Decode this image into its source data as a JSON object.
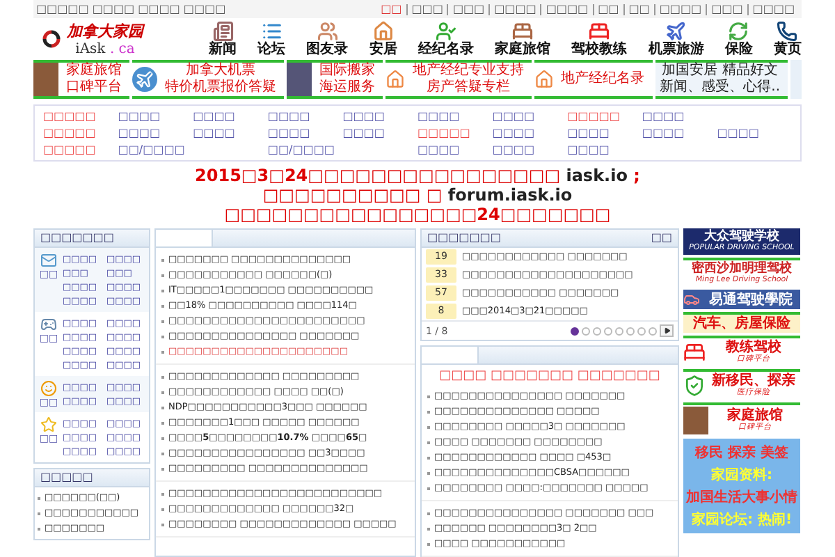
{
  "top_bar": {
    "left_text": "□□□□□ □□□□ □□□□ □□□□",
    "links": [
      {
        "label": "□□",
        "selected": true
      },
      {
        "label": "□□□",
        "selected": false
      },
      {
        "label": "□□□",
        "selected": false
      },
      {
        "label": "□□□□",
        "selected": false
      },
      {
        "label": "□□□□",
        "selected": false
      },
      {
        "label": "□□",
        "selected": false
      },
      {
        "label": "□□",
        "selected": false
      },
      {
        "label": "□□□□",
        "selected": false
      },
      {
        "label": "□□□",
        "selected": false
      },
      {
        "label": "□□□□",
        "selected": false
      }
    ]
  },
  "logo": {
    "title": "加拿大家园",
    "domain": "iAsk",
    "tld": ". ca"
  },
  "nav": [
    {
      "label": "新闻",
      "kind": "news"
    },
    {
      "label": "论坛",
      "kind": "forum"
    },
    {
      "label": "图友录",
      "kind": "people"
    },
    {
      "label": "安居",
      "kind": "house"
    },
    {
      "label": "经纪名录",
      "kind": "agents"
    },
    {
      "label": "家庭旅馆",
      "kind": "bed"
    },
    {
      "label": "驾校教练",
      "kind": "driving"
    },
    {
      "label": "机票旅游",
      "kind": "travel"
    },
    {
      "label": "保险",
      "kind": "insurance"
    },
    {
      "label": "黄页",
      "kind": "phone"
    }
  ],
  "banners": [
    {
      "lines": [
        "家庭旅馆",
        "口碑平台"
      ],
      "kind": "photo"
    },
    {
      "lines": [
        "加拿大机票",
        "特价机票报价答疑"
      ],
      "kind": "plane"
    },
    {
      "lines": [
        "国际搬家",
        "海运服务"
      ],
      "kind": "ship"
    },
    {
      "lines": [
        "地产经纪专业支持",
        "房产答疑专栏"
      ],
      "kind": "house"
    },
    {
      "lines": [
        "地产经纪名录"
      ],
      "kind": "house"
    },
    {
      "lines": [
        "加国安居 精品好文",
        "新闻、感受、心得.."
      ],
      "kind": "text"
    }
  ],
  "link_grid": [
    [
      {
        "label": "□□□□□",
        "highlighted": true,
        "kind": "normal"
      },
      {
        "label": "□□□□",
        "highlighted": false,
        "kind": "normal"
      },
      {
        "label": "□□□□",
        "highlighted": false,
        "kind": "normal"
      },
      {
        "label": "□□□□",
        "highlighted": false,
        "kind": "normal"
      },
      {
        "label": "□□□□",
        "highlighted": false,
        "kind": "normal"
      },
      {
        "label": "□□□□",
        "highlighted": false,
        "kind": "normal"
      },
      {
        "label": "□□□□",
        "highlighted": false,
        "kind": "normal"
      },
      {
        "label": "□□□□□",
        "highlighted": true,
        "kind": "normal"
      },
      {
        "label": "□□□□",
        "highlighted": false,
        "kind": "normal"
      }
    ],
    [
      {
        "label": "□□□□□",
        "highlighted": true,
        "kind": "normal"
      },
      {
        "label": "□□□□",
        "highlighted": false,
        "kind": "normal"
      },
      {
        "label": "□□□□",
        "highlighted": false,
        "kind": "normal"
      },
      {
        "label": "□□□□",
        "highlighted": false,
        "kind": "normal"
      },
      {
        "label": "□□□□",
        "highlighted": false,
        "kind": "normal"
      },
      {
        "label": "□□□□□",
        "highlighted": true,
        "kind": "normal"
      },
      {
        "label": "□□□□",
        "highlighted": false,
        "kind": "normal"
      },
      {
        "label": "□□□□",
        "highlighted": false,
        "kind": "normal"
      },
      {
        "label": "□□□□",
        "highlighted": false,
        "kind": "normal"
      },
      {
        "label": "□□□□",
        "highlighted": false,
        "kind": "normal"
      }
    ],
    [
      {
        "label": "□□□□□",
        "highlighted": true,
        "kind": "normal"
      },
      {
        "label": "□□/□□□□",
        "highlighted": false,
        "kind": "wide"
      },
      {
        "label": "□□/□□□□",
        "highlighted": false,
        "kind": "wide"
      },
      {
        "label": "□□□□",
        "highlighted": false,
        "kind": "normal"
      },
      {
        "label": "□□□□",
        "highlighted": false,
        "kind": "normal"
      },
      {
        "label": "□□□□",
        "highlighted": false,
        "kind": "normal"
      }
    ]
  ],
  "announcement": [
    [
      {
        "text": "2015□3□24□□□□□□□□□□□□□□□□",
        "emphasis": true
      },
      {
        "text": " iask.io ",
        "emphasis": false
      },
      {
        "text": ";",
        "emphasis": true
      }
    ],
    [
      {
        "text": "□□□□□□□□□□ □ ",
        "emphasis": true
      },
      {
        "text": "forum.iask.io",
        "emphasis": false
      }
    ],
    [
      {
        "text": "□□□□□□□□□□□□□□□□24□□□□□□□",
        "emphasis": true
      }
    ]
  ],
  "sidebar": {
    "title": "□□□□□□□",
    "groups": [
      {
        "kind": "mail",
        "label": "□□",
        "links": [
          "□□□□",
          "□□□□",
          "□□□",
          "□□□",
          "□□□□",
          "□□□□",
          "□□□□",
          "□□□□"
        ]
      },
      {
        "kind": "gamepad",
        "label": "□□",
        "links": [
          "□□□□",
          "□□□□",
          "□□□□",
          "□□□□",
          "□□□□",
          "□□□□",
          "□□□□",
          "□□□□"
        ]
      },
      {
        "kind": "smiley",
        "label": "□□",
        "links": [
          "□□□□",
          "□□□□",
          "□□□□",
          "□□□□"
        ]
      },
      {
        "kind": "star",
        "label": "□□",
        "links": [
          "□□□□",
          "□□□□",
          "□□□□",
          "□□□□",
          "□□□□",
          "□□□□"
        ]
      }
    ]
  },
  "sidebar_panel": {
    "title": "□□□□□",
    "items": [
      "□□□□□□(□□)",
      "□□□□□□□□□□□",
      "□□□□□□□"
    ]
  },
  "news": [
    [
      {
        "text": "□□□□□□□ □□□□□□□□□□□□□□",
        "highlighted": false
      },
      {
        "text": "□□□□□□□□□□□ □□□□□□(□)",
        "highlighted": false
      },
      {
        "text": "IT□□□□□1□□□□□□□ □□□□□□□□□□",
        "highlighted": false
      },
      {
        "text": "□□18% □□□□□□□□□□ □□□□114□",
        "highlighted": false
      },
      {
        "text": "□□□□□□□□□□□□□□□□□□□□□□□",
        "highlighted": false
      },
      {
        "text": "□□□□□□□□□□□□□□□ □□□□□□□",
        "highlighted": false
      },
      {
        "text": "□□□□□□□□□□□□□□□□□□□□□",
        "highlighted": true
      }
    ],
    [
      {
        "text": "□□□□□□□□□□□□□ □□□□□□□□□",
        "highlighted": false
      },
      {
        "text": "□□□□□□□□□□□□ □□□□ □□(□)",
        "highlighted": false
      },
      {
        "text": "NDP□□□□□□□□□□□3□□□ □□□□□□",
        "highlighted": false
      },
      {
        "text": "□□□□□□□1□□□ □□□□□ □□□□□□",
        "highlighted": false
      },
      {
        "text": "□□□□**5**□□□□□□□□**10.7%** □□□□**65**□",
        "highlighted": false
      },
      {
        "text": "□□□□□□□□□□□□□□□□ □□3□□□□",
        "highlighted": false
      },
      {
        "text": "□□□□□□□□□ □□□□□□□□□□□□□□",
        "highlighted": false
      }
    ],
    [
      {
        "text": "□□□□□□□□□□□□□□□□□□□□□□□□□",
        "highlighted": false
      },
      {
        "text": "□□□□□□□□□□□□□ □□□□□□32□",
        "highlighted": false
      },
      {
        "text": "□□□□□□□□ □□□□□□□□□□□□□ □□□□□",
        "highlighted": false
      }
    ]
  ],
  "ranking": {
    "title": "□□□□□□□",
    "more": "□□",
    "rows": [
      {
        "rank": "19",
        "text": "□□□□□□□□□□□□ □□□□□□□"
      },
      {
        "rank": "33",
        "text": "□□□□□□□□□□□□□□□□□□□□"
      },
      {
        "rank": "57",
        "text": "□□□□□□□□□□□ □□□□□□□"
      },
      {
        "rank": "8",
        "text": "□□□2014□3□21□□□□□"
      }
    ],
    "page": "1 / 8",
    "dots": [
      {
        "selected": true
      },
      {
        "selected": false
      },
      {
        "selected": false
      },
      {
        "selected": false
      },
      {
        "selected": false
      },
      {
        "selected": false
      },
      {
        "selected": false
      },
      {
        "selected": false
      }
    ]
  },
  "feature": {
    "headline": "□□□□ □□□□□□□ □□□□□□□",
    "lists": [
      [
        "□□□□□□□□□□□□□□□ □□□□□□□",
        "□□□□□□□□□□□□□□ □□□□□",
        "□□□□□□□□ □□□□□3□ □□□□□□□",
        "□□□□ □□□□□□□ □□□□□□□□",
        "□□□□□□□□□□□□ □□□□ □453□",
        "□□□□□□□□□□□□□□CBSA□□□□□□",
        "□□□□□□□□ □□□□:□□□□□□□ □□□□□"
      ],
      [
        "□□□□□□□□□□□□□□□ □□□□□□□ □□□",
        "□□□□□□ □□□□□□□□3□ 2□□",
        "□□□□ □□□□□□□□□□□"
      ]
    ]
  },
  "ads": [
    {
      "lines": [
        "大众驾驶学校",
        "POPULAR DRIVING SCHOOL"
      ],
      "kind": "navy"
    },
    {
      "lines": [
        "密西沙加明理驾校",
        "Ming Lee Driving School"
      ],
      "kind": "white"
    },
    {
      "lines": [
        "易通驾驶學院"
      ],
      "kind": "blue"
    },
    {
      "lines": [
        "汽车、房屋保险"
      ],
      "kind": "cream"
    },
    {
      "lines": [
        "教练驾校",
        "口碑平台"
      ],
      "kind": "bed"
    },
    {
      "lines": [
        "新移民、探亲",
        "医疗保险"
      ],
      "kind": "check"
    },
    {
      "lines": [
        "家庭旅馆",
        "口碑平台"
      ],
      "kind": "photo"
    }
  ],
  "promo": {
    "lines": [
      "移民 探亲 美签",
      "家园资料:",
      "加国生活大事小情",
      "家园论坛: 热闹!"
    ]
  }
}
